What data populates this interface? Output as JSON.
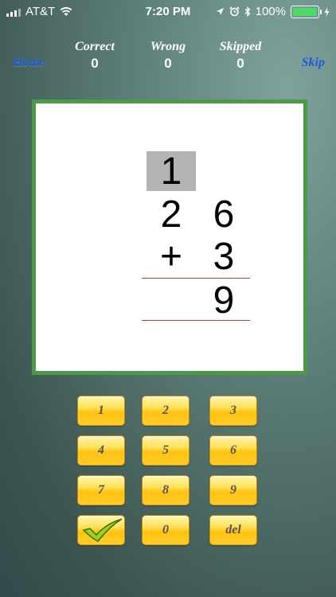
{
  "status_bar": {
    "carrier": "AT&T",
    "time": "7:20 PM",
    "battery": "100%",
    "battery_level": 1.0,
    "icons": [
      "signal-icon",
      "wifi-icon",
      "location-icon",
      "alarm-icon",
      "bluetooth-icon",
      "battery-icon",
      "charging-icon"
    ]
  },
  "nav": {
    "home_label": "Home",
    "skip_label": "Skip"
  },
  "scores": [
    {
      "label": "Correct",
      "value": "0"
    },
    {
      "label": "Wrong",
      "value": "0"
    },
    {
      "label": "Skipped",
      "value": "0"
    }
  ],
  "problem": {
    "carry": "1",
    "top_tens": "2",
    "top_ones": "6",
    "operator": "+",
    "bottom_ones": "3",
    "answer_ones": "9"
  },
  "keypad": {
    "k1": "1",
    "k2": "2",
    "k3": "3",
    "k4": "4",
    "k5": "5",
    "k6": "6",
    "k7": "7",
    "k8": "8",
    "k9": "9",
    "k0": "0",
    "del": "del"
  },
  "colors": {
    "board_border": "#4c9a46",
    "key_fill": "#ffd23a",
    "nav_link": "#1e5bd6",
    "rule": "#d23c3c"
  }
}
